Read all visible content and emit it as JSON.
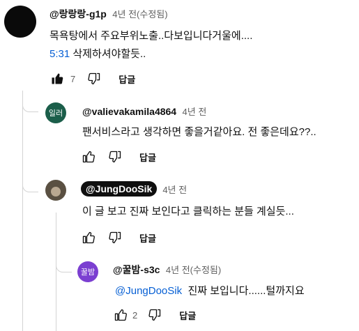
{
  "comments": [
    {
      "handle": "@랑랑랑-g1p",
      "meta": "4년 전(수정됨)",
      "line1": "목욕탕에서 주요부위노출..다보입니다거울에....",
      "timestamp": "5:31",
      "line2_rest": " 삭제하셔야할듯..",
      "likes": "7",
      "reply_label": "답글"
    },
    {
      "avatar_text": "일러",
      "handle": "@valievakamila4864",
      "meta": "4년 전",
      "text": "팬서비스라고 생각하면 좋을거같아요. 전 좋은데요??..",
      "reply_label": "답글"
    },
    {
      "handle": "@JungDooSik",
      "meta": "4년 전",
      "text": "이 글 보고 진짜 보인다고 클릭하는 분들 계실듯...",
      "reply_label": "답글"
    },
    {
      "avatar_text": "꿀밤",
      "handle": "@꿀밤-s3c",
      "meta": "4년 전(수정됨)",
      "mention": "@JungDooSik",
      "text_rest": "  진짜 보입니다......털까지요",
      "likes": "2",
      "reply_label": "답글"
    }
  ],
  "colors": {
    "link": "#065fd4",
    "avatar2": "#1b5e4a",
    "avatar4": "#7b3fd1"
  }
}
